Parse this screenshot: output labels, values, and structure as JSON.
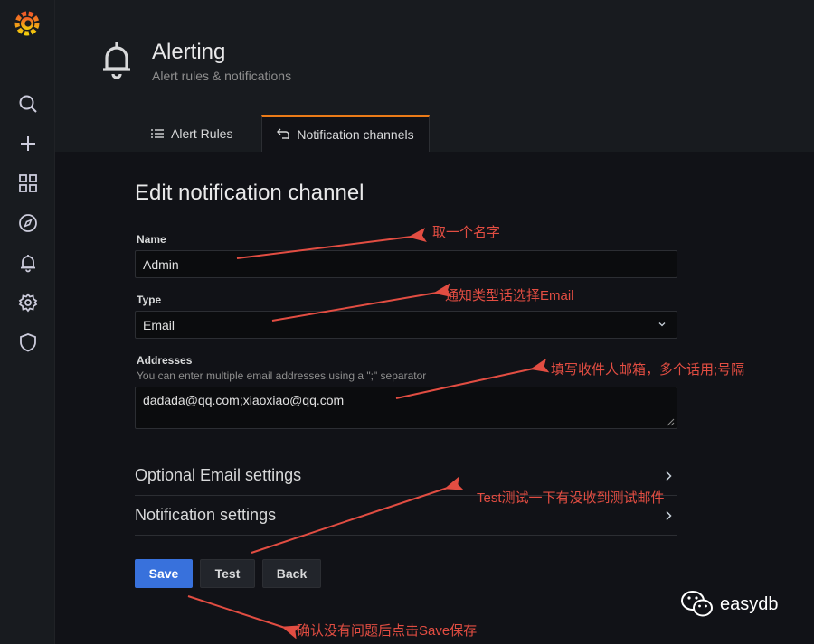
{
  "app": {
    "logo_icon": "grafana-logo-icon",
    "accent_color": "#eb7b18"
  },
  "sidebar": {
    "items": [
      {
        "name": "search",
        "icon": "search-icon"
      },
      {
        "name": "create",
        "icon": "plus-icon"
      },
      {
        "name": "dashboards",
        "icon": "dashboards-grid-icon"
      },
      {
        "name": "explore",
        "icon": "compass-icon"
      },
      {
        "name": "alerting",
        "icon": "bell-icon"
      },
      {
        "name": "configuration",
        "icon": "gear-icon"
      },
      {
        "name": "server-admin",
        "icon": "shield-icon"
      }
    ]
  },
  "header": {
    "icon": "bell-icon",
    "title": "Alerting",
    "subtitle": "Alert rules & notifications",
    "tabs": [
      {
        "label": "Alert Rules",
        "icon": "list-icon",
        "active": false
      },
      {
        "label": "Notification channels",
        "icon": "channel-icon",
        "active": true
      }
    ]
  },
  "form": {
    "title": "Edit notification channel",
    "name_label": "Name",
    "name_value": "Admin",
    "type_label": "Type",
    "type_value": "Email",
    "addresses_label": "Addresses",
    "addresses_description": "You can enter multiple email addresses using a \";\" separator",
    "addresses_value": "dadada@qq.com;xiaoxiao@qq.com",
    "optional_email_settings": "Optional Email settings",
    "notification_settings": "Notification settings"
  },
  "buttons": {
    "save": "Save",
    "test": "Test",
    "back": "Back",
    "save_color": "#3871dc"
  },
  "annotations": {
    "name_note": "取一个名字",
    "type_note": "通知类型话选择Email",
    "addresses_note": "填写收件人邮箱，多个话用;号隔",
    "test_note": "Test测试一下有没收到测试邮件",
    "save_note": "确认没有问题后点击Save保存",
    "color": "#e24d42"
  },
  "watermark": {
    "text": "easydb",
    "icon": "wechat-icon"
  }
}
